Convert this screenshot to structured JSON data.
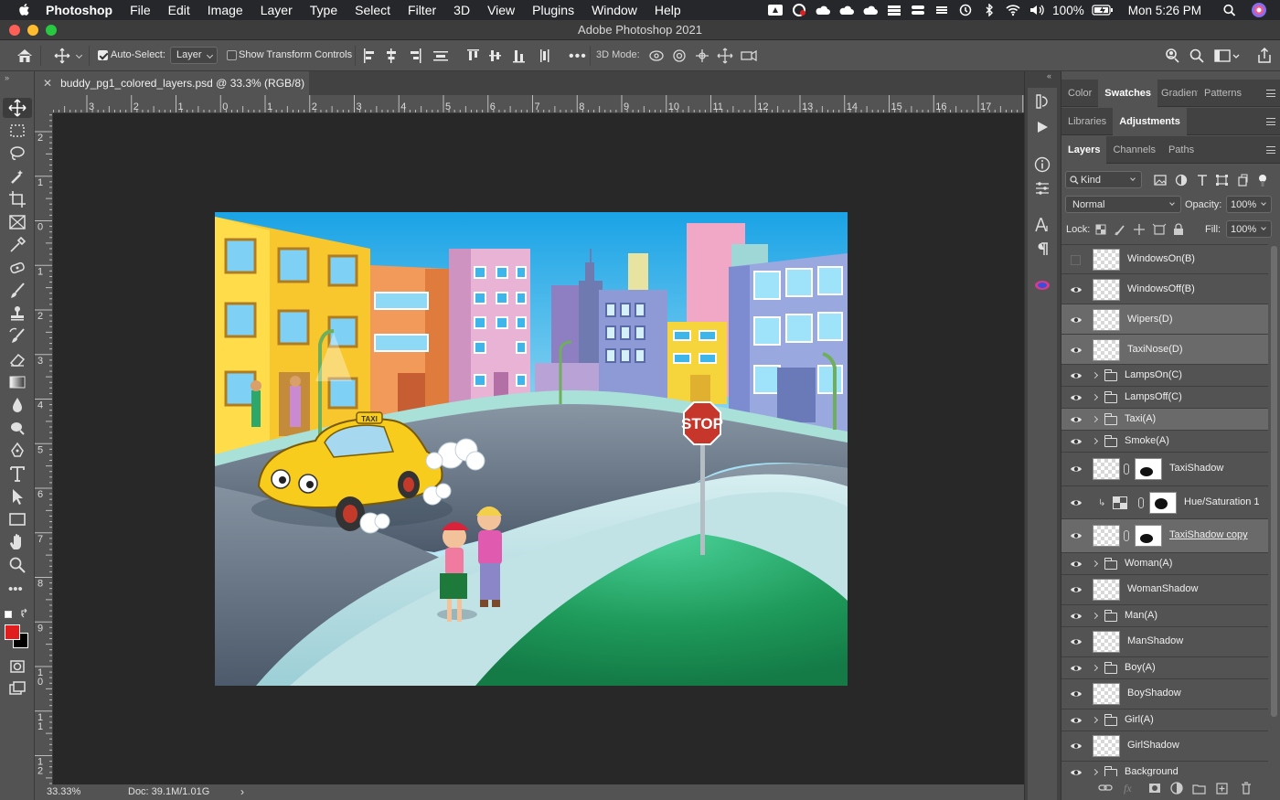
{
  "menubar": {
    "app_name": "Photoshop",
    "items": [
      "File",
      "Edit",
      "Image",
      "Layer",
      "Type",
      "Select",
      "Filter",
      "3D",
      "View",
      "Plugins",
      "Window",
      "Help"
    ],
    "battery": "100%",
    "clock": "Mon 5:26 PM"
  },
  "window": {
    "title": "Adobe Photoshop 2021"
  },
  "options_bar": {
    "auto_select_label": "Auto-Select:",
    "auto_select_checked": true,
    "auto_select_target": "Layer",
    "show_transform_label": "Show Transform Controls",
    "show_transform_checked": false,
    "mode_3d_label": "3D Mode:"
  },
  "document": {
    "tab_title": "buddy_pg1_colored_layers.psd @ 33.3% (RGB/8)",
    "zoom": "33.33%",
    "doc_size": "Doc: 39.1M/1.01G"
  },
  "rulers": {
    "horizontal": [
      "3",
      "2",
      "1",
      "0",
      "1",
      "2",
      "3",
      "4",
      "5",
      "6",
      "7",
      "8",
      "9",
      "10",
      "11",
      "12",
      "13",
      "14",
      "15",
      "16",
      "17"
    ],
    "vertical": [
      "2",
      "1",
      "0",
      "1",
      "2",
      "3",
      "4",
      "5",
      "6",
      "7",
      "8",
      "9",
      "10",
      "11",
      "12"
    ]
  },
  "colors": {
    "foreground": "#e01e1e",
    "background": "#000000",
    "accent": "#e01e1e"
  },
  "artwork": {
    "stop_sign": "STOP",
    "taxi_sign": "TAXI"
  },
  "panels": {
    "row1_tabs": [
      "Color",
      "Swatches",
      "Gradient",
      "Patterns"
    ],
    "row1_active": "Swatches",
    "row2_tabs": [
      "Libraries",
      "Adjustments"
    ],
    "row2_active": "Adjustments",
    "row3_tabs": [
      "Layers",
      "Channels",
      "Paths"
    ],
    "row3_active": "Layers",
    "filter_kind": "Kind",
    "blend_mode": "Normal",
    "opacity_label": "Opacity:",
    "opacity_value": "100%",
    "lock_label": "Lock:",
    "fill_label": "Fill:",
    "fill_value": "100%"
  },
  "layers": [
    {
      "name": "WindowsOn(B)",
      "type": "pixel",
      "visible": false,
      "selected": false
    },
    {
      "name": "WindowsOff(B)",
      "type": "pixel",
      "visible": true,
      "selected": false
    },
    {
      "name": "Wipers(D)",
      "type": "pixel",
      "visible": true,
      "selected": true
    },
    {
      "name": "TaxiNose(D)",
      "type": "pixel",
      "visible": true,
      "selected": true
    },
    {
      "name": "LampsOn(C)",
      "type": "group",
      "visible": true,
      "selected": false
    },
    {
      "name": "LampsOff(C)",
      "type": "group",
      "visible": true,
      "selected": false
    },
    {
      "name": "Taxi(A)",
      "type": "group",
      "visible": true,
      "selected": true
    },
    {
      "name": "Smoke(A)",
      "type": "group",
      "visible": true,
      "selected": false
    },
    {
      "name": "TaxiShadow",
      "type": "masked",
      "visible": true,
      "selected": false
    },
    {
      "name": "Hue/Saturation 1",
      "type": "adjustment",
      "visible": true,
      "selected": false
    },
    {
      "name": "TaxiShadow copy",
      "type": "masked",
      "visible": true,
      "selected": true
    },
    {
      "name": "Woman(A)",
      "type": "group",
      "visible": true,
      "selected": false
    },
    {
      "name": "WomanShadow",
      "type": "pixel",
      "visible": true,
      "selected": false
    },
    {
      "name": "Man(A)",
      "type": "group",
      "visible": true,
      "selected": false
    },
    {
      "name": "ManShadow",
      "type": "pixel",
      "visible": true,
      "selected": false
    },
    {
      "name": "Boy(A)",
      "type": "group",
      "visible": true,
      "selected": false
    },
    {
      "name": "BoyShadow",
      "type": "pixel",
      "visible": true,
      "selected": false
    },
    {
      "name": "Girl(A)",
      "type": "group",
      "visible": true,
      "selected": false
    },
    {
      "name": "GirlShadow",
      "type": "pixel",
      "visible": true,
      "selected": false
    },
    {
      "name": "Background",
      "type": "group",
      "visible": true,
      "selected": false
    }
  ]
}
